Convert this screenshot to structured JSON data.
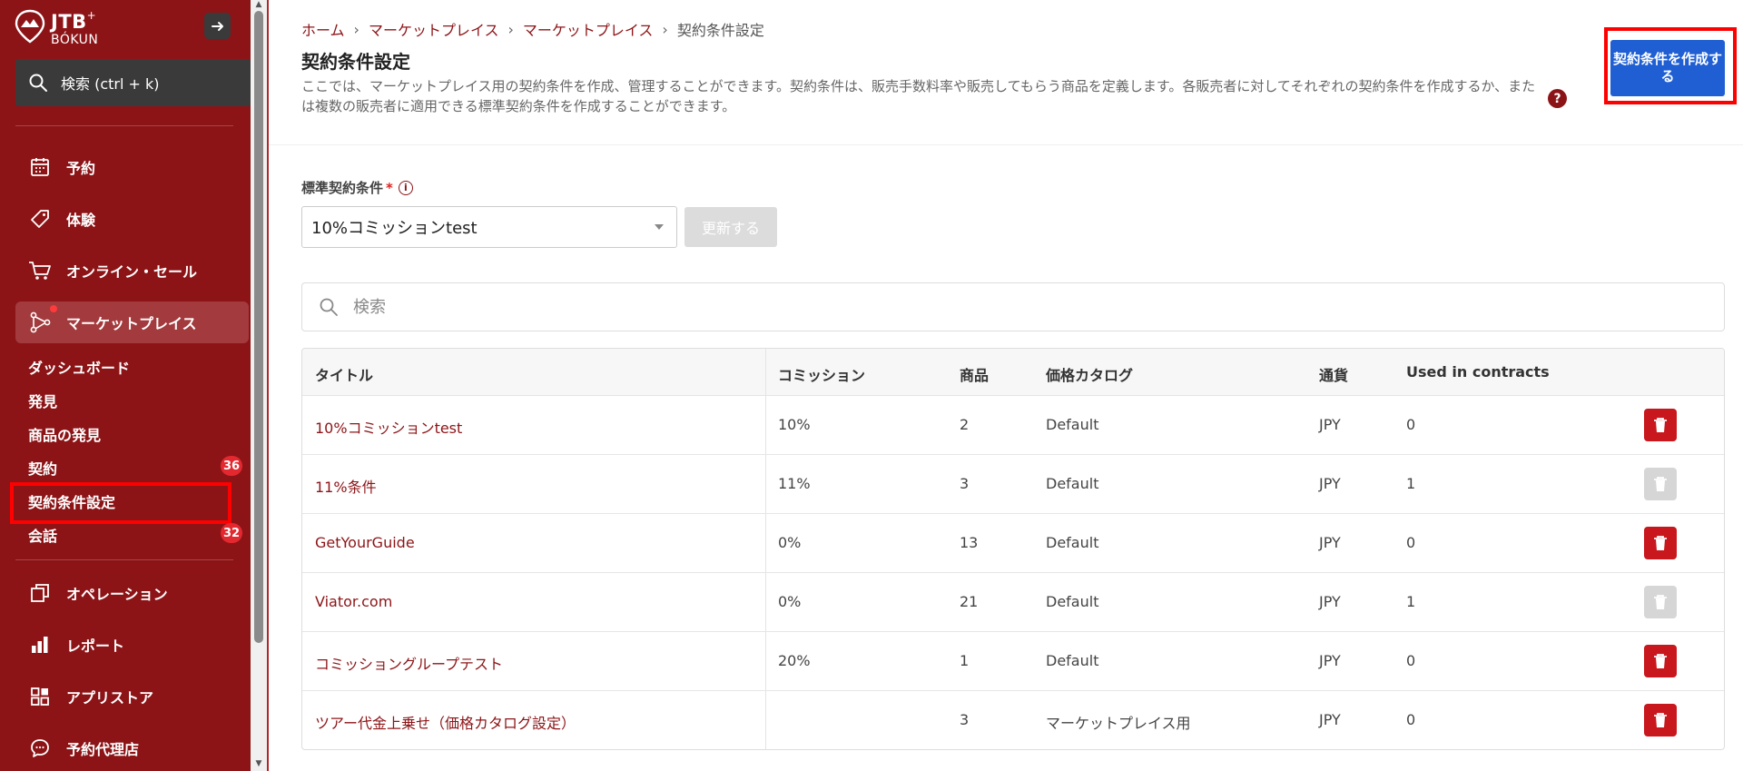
{
  "app": {
    "logo_text": "JTB",
    "logo_sup": "+",
    "logo_sub": "BÓKUN"
  },
  "sidebar": {
    "search_label": "検索 (ctrl + k)",
    "nav": [
      {
        "label": "予約",
        "icon": "calendar-icon"
      },
      {
        "label": "体験",
        "icon": "tag-icon"
      },
      {
        "label": "オンライン・セール",
        "icon": "cart-icon"
      },
      {
        "label": "マーケットプレイス",
        "icon": "network-icon"
      }
    ],
    "sub_items": [
      {
        "label": "ダッシュボード"
      },
      {
        "label": "発見"
      },
      {
        "label": "商品の発見"
      },
      {
        "label": "契約",
        "badge": "36"
      },
      {
        "label": "契約条件設定"
      },
      {
        "label": "会話",
        "badge": "32"
      }
    ],
    "nav_bottom": [
      {
        "label": "オペレーション",
        "icon": "copy-icon"
      },
      {
        "label": "レポート",
        "icon": "bar-chart-icon"
      },
      {
        "label": "アプリストア",
        "icon": "grid-icon"
      },
      {
        "label": "予約代理店",
        "icon": "chat-icon"
      }
    ]
  },
  "breadcrumb": [
    {
      "label": "ホーム"
    },
    {
      "label": "マーケットプレイス"
    },
    {
      "label": "マーケットプレイス"
    },
    {
      "label": "契約条件設定"
    }
  ],
  "breadcrumb_sep": "›",
  "page": {
    "title": "契約条件設定",
    "description": "ここでは、マーケットプレイス用の契約条件を作成、管理することができます。契約条件は、販売手数料率や販売してもらう商品を定義します。各販売者に対してそれぞれの契約条件を作成するか、または複数の販売者に適用できる標準契約条件を作成することができます。",
    "help": "?",
    "create_button": "契約条件を作成する"
  },
  "standard_terms": {
    "label": "標準契約条件",
    "required_mark": "*",
    "info": "i",
    "selected_value": "10%コミッションtest",
    "update_button": "更新する"
  },
  "table_search": {
    "placeholder": "検索"
  },
  "table": {
    "headers": [
      "タイトル",
      "コミッション",
      "商品",
      "価格カタログ",
      "通貨",
      "Used in contracts"
    ],
    "rows": [
      {
        "title": "10%コミッションtest",
        "commission": "10%",
        "products": "2",
        "catalog": "Default",
        "currency": "JPY",
        "used": "0",
        "deletable": true
      },
      {
        "title": "11%条件",
        "commission": "11%",
        "products": "3",
        "catalog": "Default",
        "currency": "JPY",
        "used": "1",
        "deletable": false
      },
      {
        "title": "GetYourGuide",
        "commission": "0%",
        "products": "13",
        "catalog": "Default",
        "currency": "JPY",
        "used": "0",
        "deletable": true
      },
      {
        "title": "Viator.com",
        "commission": "0%",
        "products": "21",
        "catalog": "Default",
        "currency": "JPY",
        "used": "1",
        "deletable": false
      },
      {
        "title": "コミッショングループテスト",
        "commission": "20%",
        "products": "1",
        "catalog": "Default",
        "currency": "JPY",
        "used": "0",
        "deletable": true
      },
      {
        "title": "ツアー代金上乗せ（価格カタログ設定）",
        "commission": "",
        "products": "3",
        "catalog": "マーケットプレイス用",
        "currency": "JPY",
        "used": "0",
        "deletable": true
      }
    ]
  },
  "colors": {
    "sidebar_bg": "#8c1417",
    "accent_red": "#c8171d",
    "primary_blue": "#1f5fd3",
    "highlight_frame": "#ff0000"
  }
}
